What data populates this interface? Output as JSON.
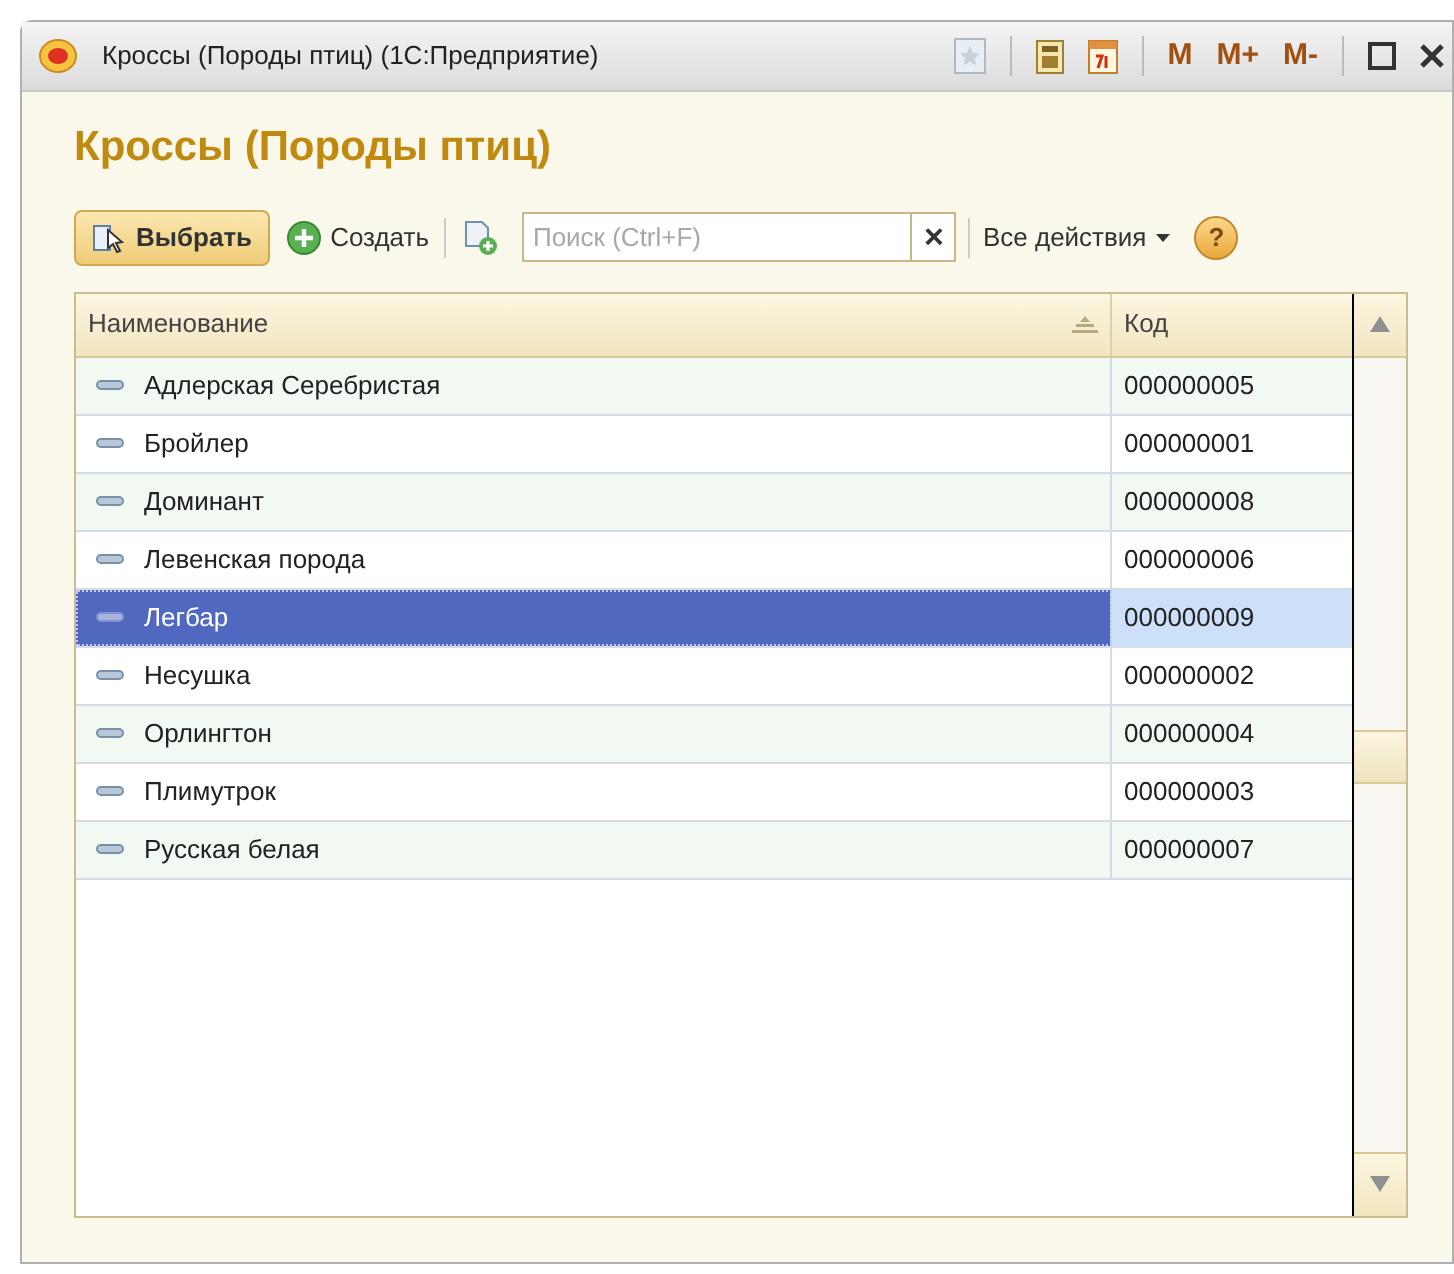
{
  "window": {
    "title": "Кроссы (Породы птиц)  (1С:Предприятие)",
    "buttons": [
      "M",
      "M+",
      "M-"
    ]
  },
  "heading": "Кроссы (Породы птиц)",
  "toolbar": {
    "select_button": "Выбрать",
    "create_button": "Создать",
    "search": {
      "placeholder": "Поиск (Ctrl+F)"
    },
    "clear_button": "×",
    "all_actions": "Все действия",
    "help": "?"
  },
  "table": {
    "columns": [
      "Наименование",
      "Код"
    ],
    "rows": [
      {
        "name": "Адлерская Серебристая",
        "code": "000000005",
        "selected": false
      },
      {
        "name": "Бройлер",
        "code": "000000001",
        "selected": false
      },
      {
        "name": "Доминант",
        "code": "000000008",
        "selected": false
      },
      {
        "name": "Левенская порода",
        "code": "000000006",
        "selected": false
      },
      {
        "name": "Легбар",
        "code": "000000009",
        "selected": true
      },
      {
        "name": "Несушка",
        "code": "000000002",
        "selected": false
      },
      {
        "name": "Орлингтон",
        "code": "000000004",
        "selected": false
      },
      {
        "name": "Плимутрок",
        "code": "000000003",
        "selected": false
      },
      {
        "name": "Русская белая",
        "code": "000000007",
        "selected": false
      }
    ]
  }
}
